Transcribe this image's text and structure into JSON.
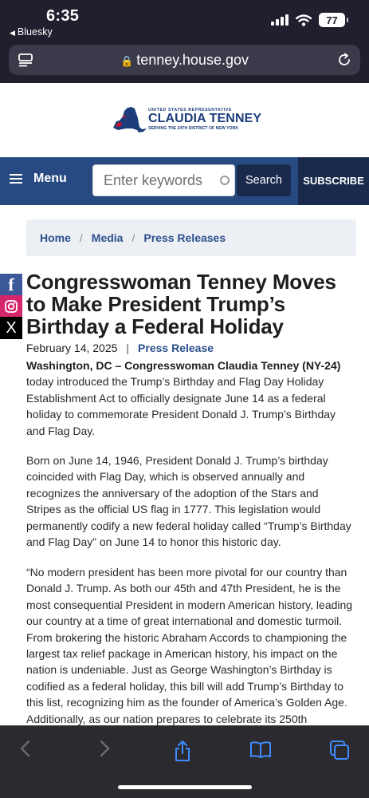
{
  "status_bar": {
    "time": "6:35",
    "back_app": "Bluesky",
    "battery": "77"
  },
  "browser": {
    "url": "tenney.house.gov"
  },
  "site": {
    "logo_small": "UNITED STATES REPRESENTATIVE",
    "logo_name": "CLAUDIA TENNEY",
    "logo_tag": "SERVING THE 24TH DISTRICT OF NEW YORK",
    "brand_blue": "#1c3d7a",
    "brand_red": "#c8102e"
  },
  "nav": {
    "menu_label": "Menu",
    "search_placeholder": "Enter keywords",
    "search_button": "Search",
    "subscribe_button": "SUBSCRIBE",
    "nav_color": "#274a82"
  },
  "breadcrumb": [
    "Home",
    "Media",
    "Press Releases"
  ],
  "social": {
    "facebook": "f",
    "x": "X"
  },
  "article": {
    "title": "Congresswoman Tenney Moves to Make President Trump’s Birthday a Federal Holiday",
    "date": "February 14, 2025",
    "category": "Press Release",
    "p1_lead": "Washington, DC – Congresswoman Claudia Tenney (NY-24)",
    "p1_rest": " today introduced the Trump’s Birthday and Flag Day Holiday Establishment Act to officially designate June 14 as a federal holiday to commemorate President Donald J. Trump’s Birthday and Flag Day.",
    "p2": "Born on June 14, 1946, President Donald J. Trump’s birthday coincided with Flag Day, which is observed annually and recognizes the anniversary of the adoption of the Stars and Stripes as the official US flag in 1777. This legislation would permanently codify a new federal holiday called “Trump’s Birthday and Flag Day” on June 14 to honor this historic day.",
    "p3": "“No modern president has been more pivotal for our country than Donald J. Trump. As both our 45th and 47th President, he is the most consequential President in modern American history, leading our country at a time of great international and domestic turmoil. From brokering the historic Abraham Accords to championing the largest tax relief package in American history, his impact on the nation is undeniable. Just as George Washington’s Birthday is codified as a federal holiday, this bill will add Trump’s Birthday to this list, recognizing him as the founder of America’s Golden Age. Additionally, as our nation prepares to celebrate its 250th"
  },
  "toolbar": {
    "icons": [
      "back-icon",
      "forward-icon",
      "share-icon",
      "bookmarks-icon",
      "tabs-icon"
    ],
    "active_color": "#3f8cff"
  }
}
